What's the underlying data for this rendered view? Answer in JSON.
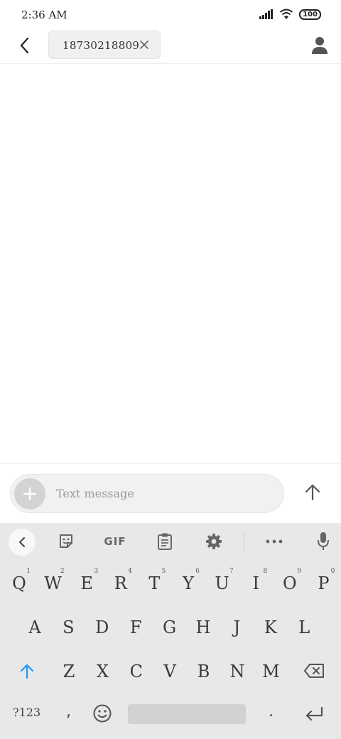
{
  "status_bar": {
    "time": "2:36 AM",
    "battery": "100",
    "icons": [
      "signal-icon",
      "wifi-icon",
      "battery-icon"
    ]
  },
  "header": {
    "back_icon": "chevron-left-icon",
    "recipient_chip": "18730218809",
    "chip_close_icon": "close-icon",
    "contact_icon": "person-icon"
  },
  "compose": {
    "add_icon": "plus-icon",
    "placeholder": "Text message",
    "send_icon": "arrow-up-icon"
  },
  "keyboard": {
    "toolbar": {
      "back_icon": "chevron-left-icon",
      "sticker_icon": "sticker-icon",
      "gif_label": "GIF",
      "clipboard_icon": "clipboard-icon",
      "settings_icon": "gear-icon",
      "more_icon": "more-icon",
      "mic_icon": "mic-icon"
    },
    "row1": [
      {
        "key": "Q",
        "hint": "1"
      },
      {
        "key": "W",
        "hint": "2"
      },
      {
        "key": "E",
        "hint": "3"
      },
      {
        "key": "R",
        "hint": "4"
      },
      {
        "key": "T",
        "hint": "5"
      },
      {
        "key": "Y",
        "hint": "6"
      },
      {
        "key": "U",
        "hint": "7"
      },
      {
        "key": "I",
        "hint": "8"
      },
      {
        "key": "O",
        "hint": "9"
      },
      {
        "key": "P",
        "hint": "0"
      }
    ],
    "row2": [
      "A",
      "S",
      "D",
      "F",
      "G",
      "H",
      "J",
      "K",
      "L"
    ],
    "row3": [
      "Z",
      "X",
      "C",
      "V",
      "B",
      "N",
      "M"
    ],
    "symbols_label": "?123",
    "comma": ",",
    "period": ".",
    "accent_color": "#2196f3"
  }
}
